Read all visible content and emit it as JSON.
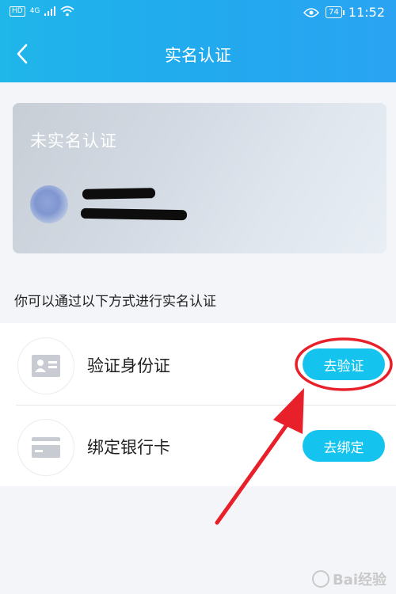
{
  "status_bar": {
    "network_badge": "HD",
    "network_type": "4G",
    "battery": "74",
    "time": "11:52"
  },
  "header": {
    "title": "实名认证",
    "back_icon": "chevron-left-icon"
  },
  "card": {
    "status": "未实名认证",
    "avatar": "avatar-icon"
  },
  "hint": "你可以通过以下方式进行实名认证",
  "options": [
    {
      "icon": "id-card-icon",
      "label": "验证身份证",
      "button": "去验证"
    },
    {
      "icon": "bank-card-icon",
      "label": "绑定银行卡",
      "button": "去绑定"
    }
  ],
  "annotations": {
    "arrow_color": "#e8202a",
    "circle_color": "#e8202a"
  },
  "colors": {
    "accent": "#1fb6ea",
    "button": "#14c4ee"
  },
  "watermark": "Bai经验"
}
